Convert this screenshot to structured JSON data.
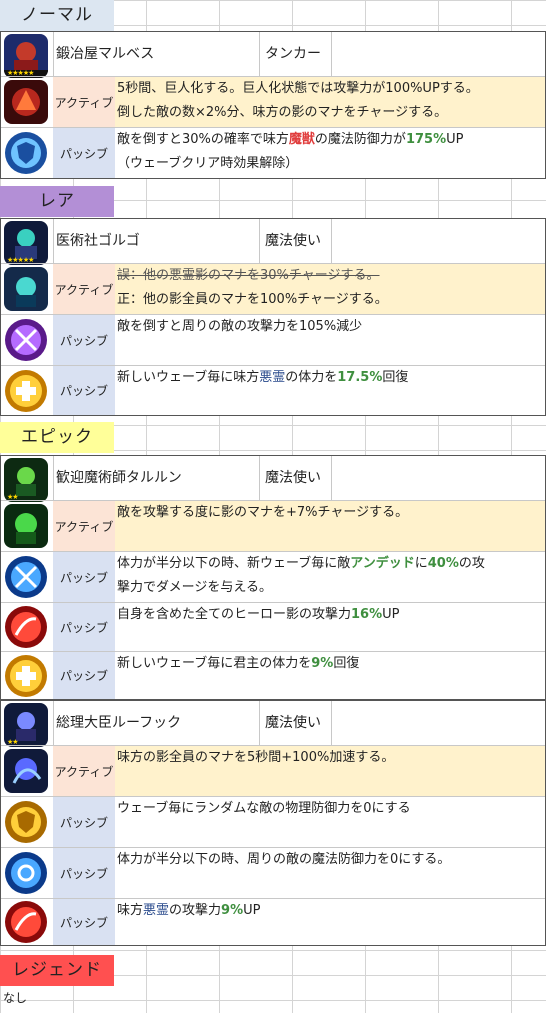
{
  "sections": {
    "normal": "ノーマル",
    "rare": "レア",
    "epic": "エピック",
    "legend": "レジェンド"
  },
  "legend_value": "なし",
  "types": {
    "active": "アクティブ",
    "passive": "パッシブ"
  },
  "normal": {
    "name": "鍛冶屋マルベス",
    "role": "タンカー",
    "active": {
      "line1": "5秒間、巨人化する。巨人化状態では攻撃力が100%UPする。",
      "line2": "倒した敵の数×2%分、味方の影のマナをチャージする。"
    },
    "passive": {
      "p1": "敵を倒すと30%の確率で味方",
      "p1_red": "魔獣",
      "p1_b": "の魔法防御力が",
      "p1_green": "175%",
      "p1_c": "UP",
      "line2": "（ウェーブクリア時効果解除）"
    }
  },
  "rare": {
    "name": "医術社ゴルゴ",
    "role": "魔法使い",
    "active": {
      "line1": "誤：他の悪霊影のマナを30%チャージする。",
      "line2": "正：他の影全員のマナを100%チャージする。"
    },
    "passive1": "敵を倒すと周りの敵の攻撃力を105%減少",
    "passive2": {
      "a": "新しいウェーブ毎に味方",
      "blue": "悪霊",
      "b": "の体力を",
      "green": "17.5%",
      "c": "回復"
    }
  },
  "epic1": {
    "name": "歓迎魔術師タルルン",
    "role": "魔法使い",
    "active": "敵を攻撃する度に影のマナを+7%チャージする。",
    "passive1": {
      "a": "体力が半分以下の時、新ウェーブ毎に敵",
      "green": "アンデッド",
      "b": "に",
      "green2": "40%",
      "c": "の攻",
      "line2": "撃力でダメージを与える。"
    },
    "passive2": {
      "a": "自身を含めた全てのヒーロー影の攻撃力",
      "green": "16%",
      "b": "UP"
    },
    "passive3": {
      "a": "新しいウェーブ毎に君主の体力を",
      "green": "9%",
      "b": "回復"
    }
  },
  "epic2": {
    "name": "総理大臣ルーフック",
    "role": "魔法使い",
    "active": "味方の影全員のマナを5秒間+100%加速する。",
    "passive1": "ウェーブ毎にランダムな敵の物理防御力を0にする",
    "passive2": "体力が半分以下の時、周りの敵の魔法防御力を0にする。",
    "passive3": {
      "a": "味方",
      "blue": "悪霊",
      "b": "の攻撃力",
      "green": "9%",
      "c": "UP"
    }
  },
  "colors": {
    "normal_header": "#dce6f1",
    "rare_header": "#b38fd6",
    "epic_header": "#ffff99",
    "legend_header": "#ff5050",
    "active_bg": "#fce4d6",
    "active_desc_bg": "#fff2cc",
    "passive_bg": "#d9e1f2"
  }
}
